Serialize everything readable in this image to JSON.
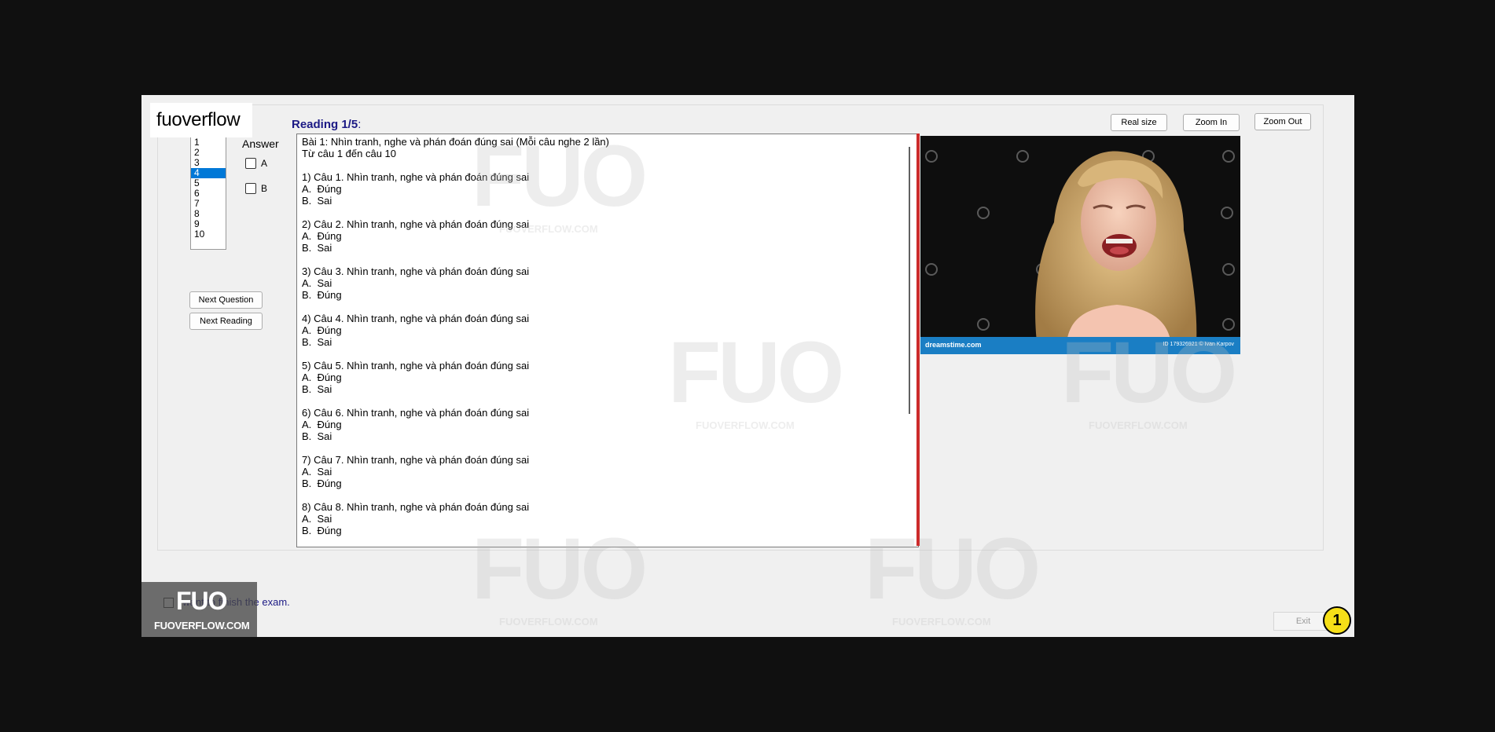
{
  "brand": "fuoverflow",
  "reading_title": "Reading 1/5",
  "reading_title_suffix": ":",
  "question_list": [
    "1",
    "2",
    "3",
    "4",
    "5",
    "6",
    "7",
    "8",
    "9",
    "10"
  ],
  "selected_question": "4",
  "answer": {
    "label": "Answer",
    "options": [
      "A",
      "B"
    ]
  },
  "buttons": {
    "next_question": "Next Question",
    "next_reading": "Next Reading",
    "real_size": "Real size",
    "zoom_in": "Zoom In",
    "zoom_out": "Zoom Out",
    "exit": "Exit"
  },
  "reading_text": {
    "header": "Bài 1: Nhìn tranh, nghe và phán đoán đúng sai (Mỗi câu nghe 2 lần)",
    "subheader": "Từ câu 1 đến câu 10",
    "questions": [
      {
        "q": "1) Câu 1. Nhìn tranh, nghe và phán đoán đúng sai",
        "a": "A.  Đúng",
        "b": "B.  Sai"
      },
      {
        "q": "2) Câu 2. Nhìn tranh, nghe và phán đoán đúng sai",
        "a": "A.  Đúng",
        "b": "B.  Sai"
      },
      {
        "q": "3) Câu 3. Nhìn tranh, nghe và phán đoán đúng sai",
        "a": "A.  Sai",
        "b": "B.  Đúng"
      },
      {
        "q": "4) Câu 4. Nhìn tranh, nghe và phán đoán đúng sai",
        "a": "A.  Đúng",
        "b": "B.  Sai"
      },
      {
        "q": "5) Câu 5. Nhìn tranh, nghe và phán đoán đúng sai",
        "a": "A.  Đúng",
        "b": "B.  Sai"
      },
      {
        "q": "6) Câu 6. Nhìn tranh, nghe và phán đoán đúng sai",
        "a": "A.  Đúng",
        "b": "B.  Sai"
      },
      {
        "q": "7) Câu 7. Nhìn tranh, nghe và phán đoán đúng sai",
        "a": "A.  Sai",
        "b": "B.  Đúng"
      },
      {
        "q": "8) Câu 8. Nhìn tranh, nghe và phán đoán đúng sai",
        "a": "A.  Sai",
        "b": "B.  Đúng"
      }
    ]
  },
  "image": {
    "footer_left": "dreamstime.com",
    "footer_right": "ID 179326921 © Ivan Karpov"
  },
  "finish": {
    "label": "I want to finish the exam."
  },
  "logo": {
    "mark": "FUO",
    "site": "FUOVERFLOW.COM"
  },
  "watermark": {
    "mark": "FUO",
    "site": "FUOVERFLOW.COM"
  },
  "badge": "1",
  "colors": {
    "title": "#1c1a85",
    "selection": "#0078d7",
    "divider": "#cc2b2b",
    "badge": "#f6df18",
    "image_footer": "#1a7ec4"
  }
}
